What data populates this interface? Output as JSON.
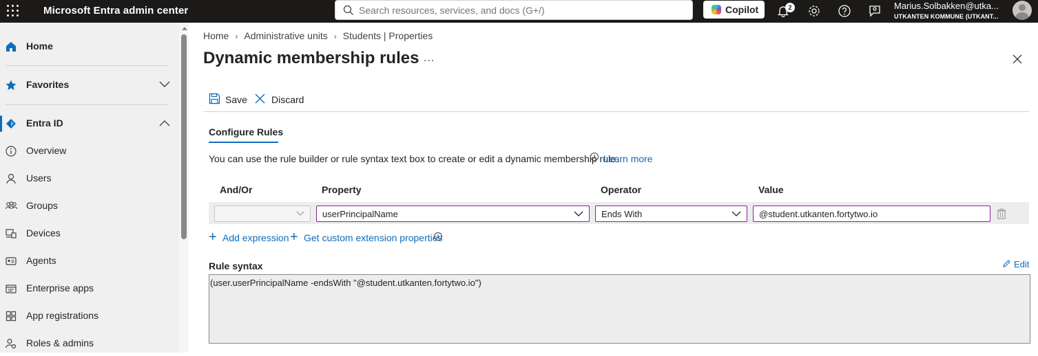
{
  "topbar": {
    "app_title": "Microsoft Entra admin center",
    "search_placeholder": "Search resources, services, and docs (G+/)",
    "copilot_label": "Copilot",
    "notification_count": "2",
    "user_name": "Marius.Solbakken@utka...",
    "user_org": "UTKANTEN KOMMUNE (UTKANT..."
  },
  "sidebar": {
    "home": "Home",
    "favorites": "Favorites",
    "entra_id": "Entra ID",
    "items": [
      {
        "label": "Overview",
        "icon": "info-icon"
      },
      {
        "label": "Users",
        "icon": "user-icon"
      },
      {
        "label": "Groups",
        "icon": "groups-icon"
      },
      {
        "label": "Devices",
        "icon": "devices-icon"
      },
      {
        "label": "Agents",
        "icon": "agents-icon"
      },
      {
        "label": "Enterprise apps",
        "icon": "enterprise-apps-icon"
      },
      {
        "label": "App registrations",
        "icon": "app-registrations-icon"
      },
      {
        "label": "Roles & admins",
        "icon": "roles-icon"
      }
    ]
  },
  "breadcrumb": [
    "Home",
    "Administrative units",
    "Students | Properties"
  ],
  "page": {
    "title": "Dynamic membership rules",
    "more": "...",
    "save_label": "Save",
    "discard_label": "Discard",
    "tab_label": "Configure Rules",
    "description": "You can use the rule builder or rule syntax text box to create or edit a dynamic membership rule.",
    "learn_more": "Learn more"
  },
  "rule_table": {
    "headers": {
      "and_or": "And/Or",
      "property": "Property",
      "operator": "Operator",
      "value": "Value"
    },
    "row": {
      "and_or": "",
      "property": "userPrincipalName",
      "operator": "Ends With",
      "value": "@student.utkanten.fortytwo.io"
    }
  },
  "actions": {
    "add_expression": "Add expression",
    "custom_extension": "Get custom extension properties"
  },
  "rule_syntax": {
    "label": "Rule syntax",
    "edit_label": "Edit",
    "text": "(user.userPrincipalName -endsWith \"@student.utkanten.fortytwo.io\")"
  },
  "colors": {
    "accent": "#0f6cbd",
    "focus_border": "#8a1f9a",
    "topbar_bg": "#1b1a19",
    "sidebar_bg": "#f0f0f0"
  }
}
